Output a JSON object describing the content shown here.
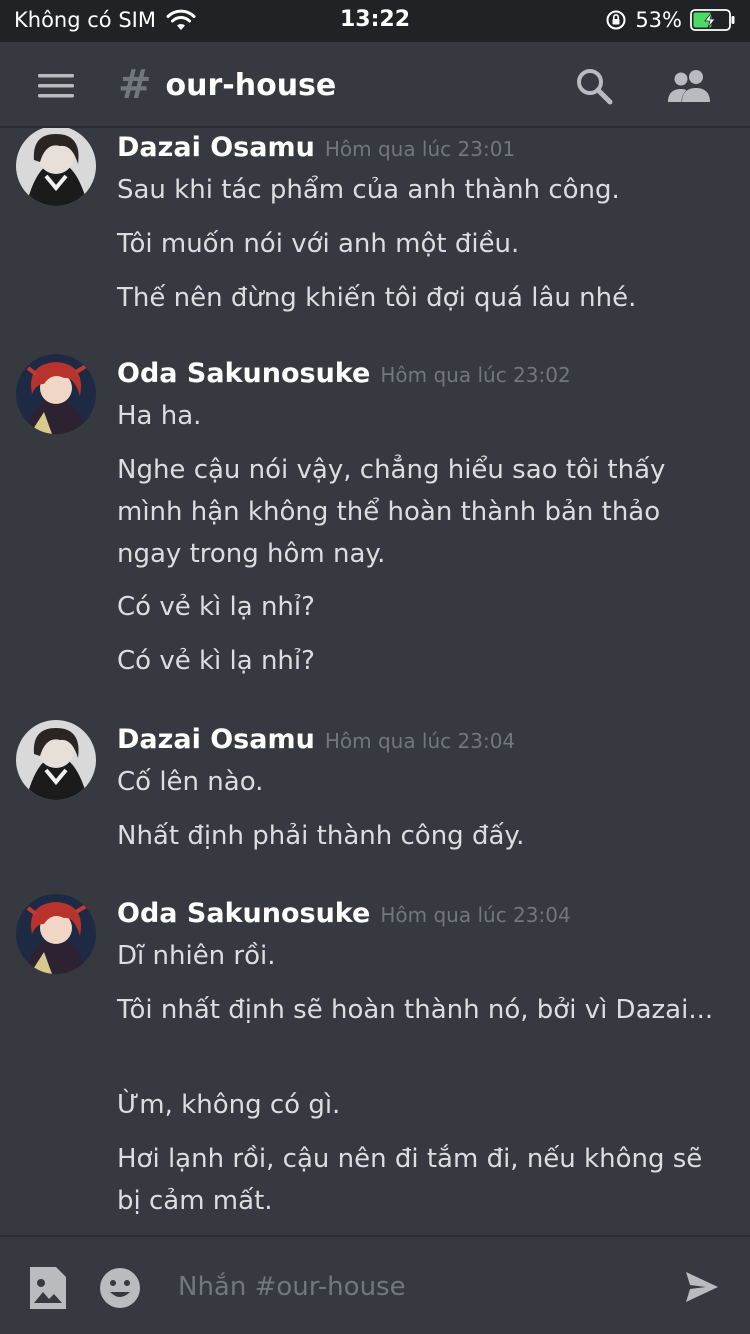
{
  "status_bar": {
    "carrier": "Không có SIM",
    "time": "13:22",
    "battery_percent": "53%",
    "battery_level": 0.53,
    "icons": [
      "wifi-icon",
      "orientation-lock-icon",
      "battery-charging-icon"
    ]
  },
  "header": {
    "hash": "#",
    "channel_name": "our-house",
    "icons": [
      "menu-icon",
      "search-icon",
      "members-icon"
    ]
  },
  "messages": [
    {
      "author": "Dazai Osamu",
      "timestamp": "Hôm qua lúc 23:01",
      "lines": [
        "Sau khi tác phẩm của anh thành công.",
        "Tôi muốn nói với anh một điều.",
        "Thế nên đừng khiến tôi đợi quá lâu nhé."
      ]
    },
    {
      "author": "Oda Sakunosuke",
      "timestamp": "Hôm qua lúc 23:02",
      "lines": [
        "Ha ha.",
        "Nghe cậu nói vậy, chẳng hiểu sao tôi thấy mình hận không thể hoàn thành bản thảo ngay trong hôm nay.",
        "Có vẻ kì lạ nhỉ?",
        "Có vẻ kì lạ nhỉ?"
      ]
    },
    {
      "author": "Dazai Osamu",
      "timestamp": "Hôm qua lúc 23:04",
      "lines": [
        "Cố lên nào.",
        "Nhất định phải thành công đấy."
      ]
    },
    {
      "author": "Oda Sakunosuke",
      "timestamp": "Hôm qua lúc 23:04",
      "lines": [
        "Dĩ nhiên rồi.",
        "Tôi nhất định sẽ hoàn thành nó, bởi vì Dazai...",
        "Ừm, không có gì.",
        "Hơi lạnh rồi, cậu nên đi tắm đi, nếu không sẽ bị cảm mất."
      ]
    }
  ],
  "composer": {
    "placeholder": "Nhắn #our-house",
    "value": "",
    "icons": [
      "image-icon",
      "emoji-icon",
      "send-icon"
    ]
  },
  "colors": {
    "background": "#36393f",
    "status_bar": "#202225",
    "text": "#dcddde",
    "muted": "#72767d",
    "author": "#ffffff",
    "battery_green": "#4cd964"
  }
}
